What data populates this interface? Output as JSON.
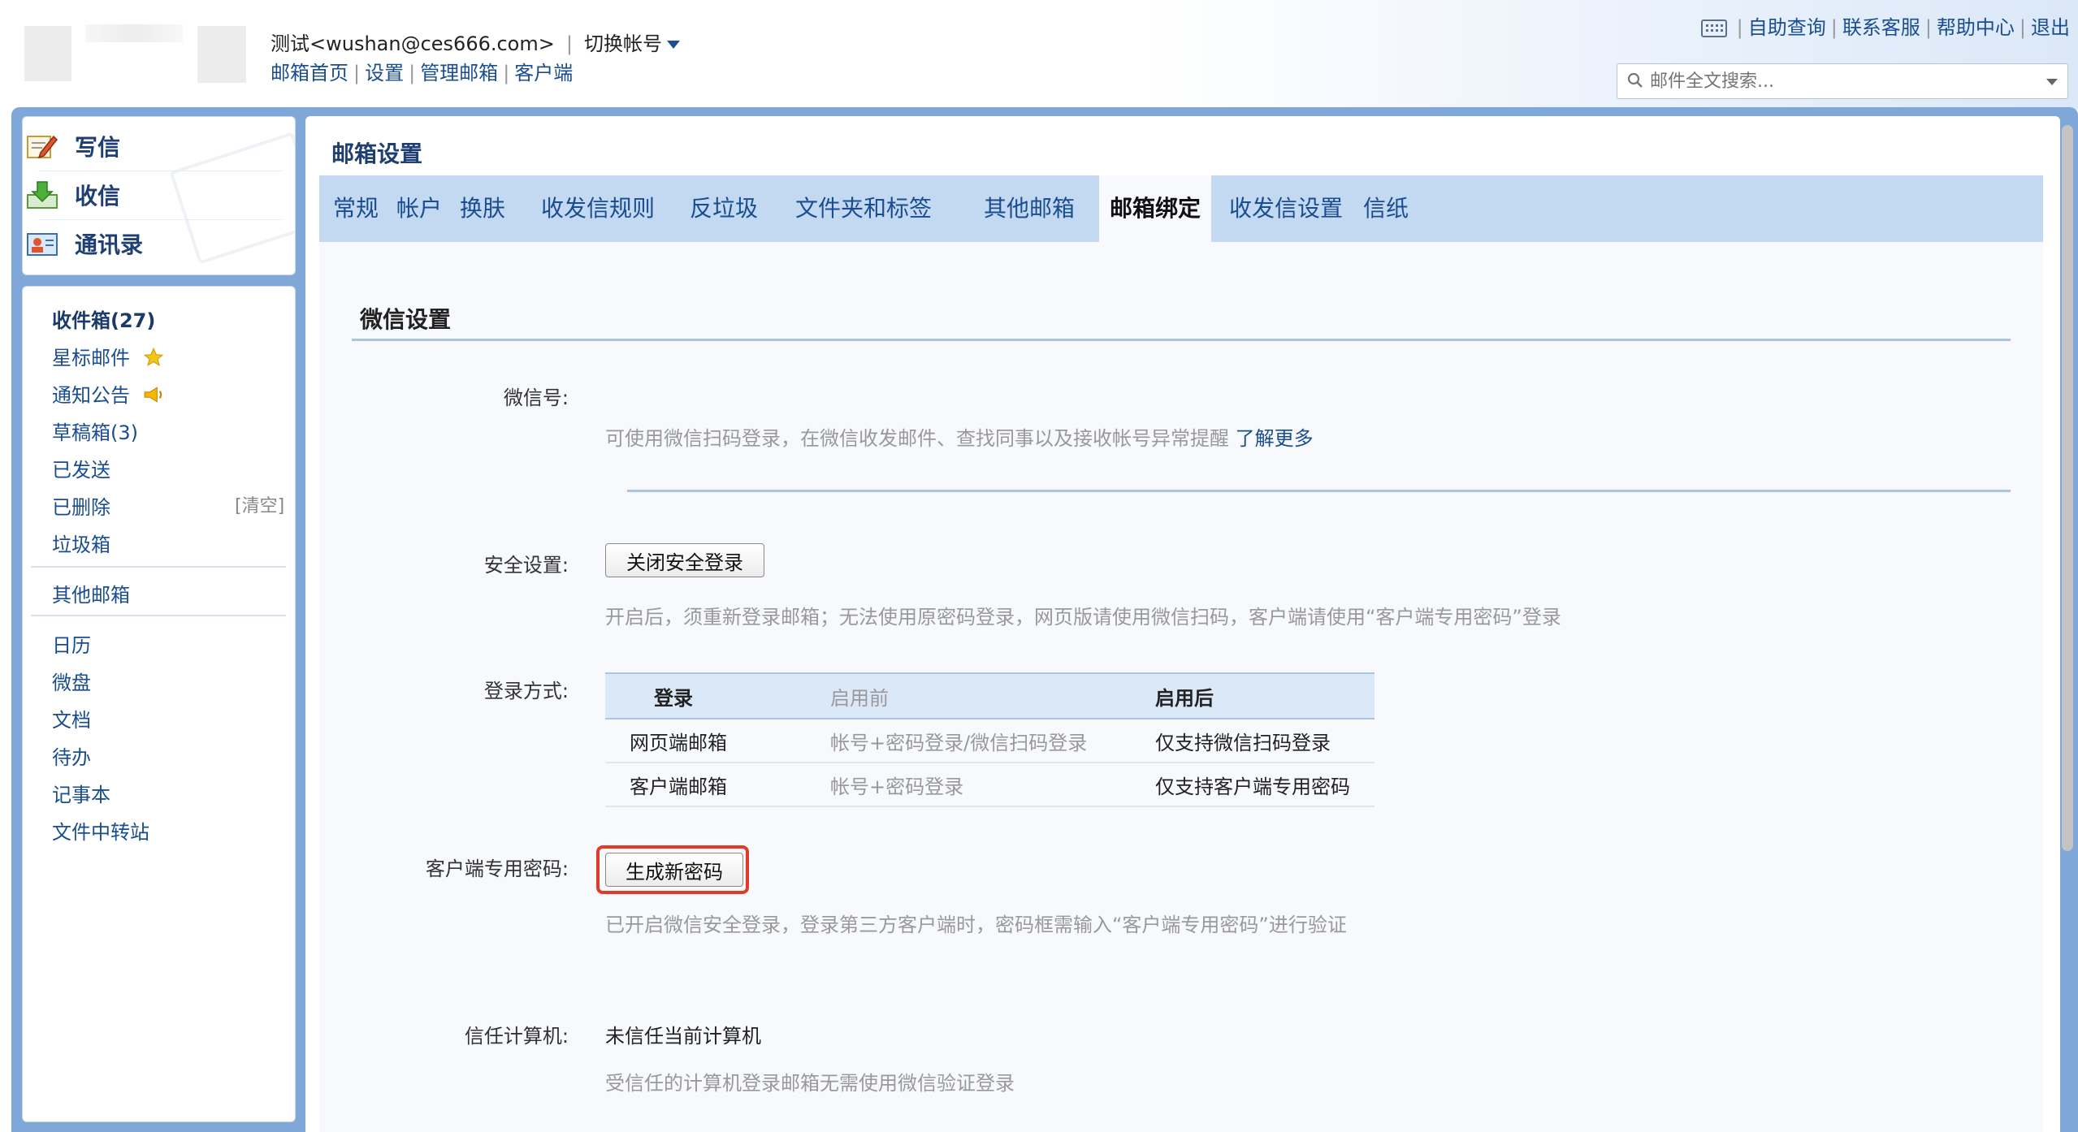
{
  "header": {
    "account_display": "测试<wushan@ces666.com>",
    "switch_account": "切换帐号",
    "links": [
      "邮箱首页",
      "设置",
      "管理邮箱",
      "客户端"
    ],
    "util_links": [
      "自助查询",
      "联系客服",
      "帮助中心",
      "退出"
    ],
    "search_placeholder": "邮件全文搜索..."
  },
  "sidebar": {
    "compose": "写信",
    "receive": "收信",
    "contacts": "通讯录",
    "folders": {
      "inbox": "收件箱(27)",
      "starred": "星标邮件",
      "notices": "通知公告",
      "drafts": "草稿箱(3)",
      "sent": "已发送",
      "deleted": "已删除",
      "clear": "[清空]",
      "spam": "垃圾箱",
      "other_mailboxes": "其他邮箱"
    },
    "apps": [
      "日历",
      "微盘",
      "文档",
      "待办",
      "记事本",
      "文件中转站"
    ]
  },
  "main": {
    "title": "邮箱设置",
    "tabs": [
      "常规",
      "帐户",
      "换肤",
      "收发信规则",
      "反垃圾",
      "文件夹和标签",
      "其他邮箱",
      "邮箱绑定",
      "收发信设置",
      "信纸"
    ],
    "active_tab": "邮箱绑定"
  },
  "wechat": {
    "section_title": "微信设置",
    "wechat_id_label": "微信号:",
    "wechat_hint": "可使用微信扫码登录，在微信收发邮件、查找同事以及接收帐号异常提醒",
    "learn_more": "了解更多",
    "security_label": "安全设置:",
    "security_button": "关闭安全登录",
    "security_hint": "开启后，须重新登录邮箱；无法使用原密码登录，网页版请使用微信扫码，客户端请使用“客户端专用密码”登录",
    "login_method_label": "登录方式:",
    "login_table": {
      "headers": [
        "登录",
        "启用前",
        "启用后"
      ],
      "rows": [
        [
          "网页端邮箱",
          "帐号+密码登录/微信扫码登录",
          "仅支持微信扫码登录"
        ],
        [
          "客户端邮箱",
          "帐号+密码登录",
          "仅支持客户端专用密码"
        ]
      ]
    },
    "client_password_label": "客户端专用密码:",
    "client_password_button": "生成新密码",
    "client_password_hint": "已开启微信安全登录，登录第三方客户端时，密码框需输入“客户端专用密码”进行验证",
    "trusted_label": "信任计算机:",
    "trusted_value": "未信任当前计算机",
    "trusted_hint": "受信任的计算机登录邮箱无需使用微信验证登录"
  },
  "colors": {
    "frame": "#7fa8d8",
    "tabbar": "#c3d9f2",
    "link": "#1a4d8f",
    "highlight": "#e03a2a"
  }
}
